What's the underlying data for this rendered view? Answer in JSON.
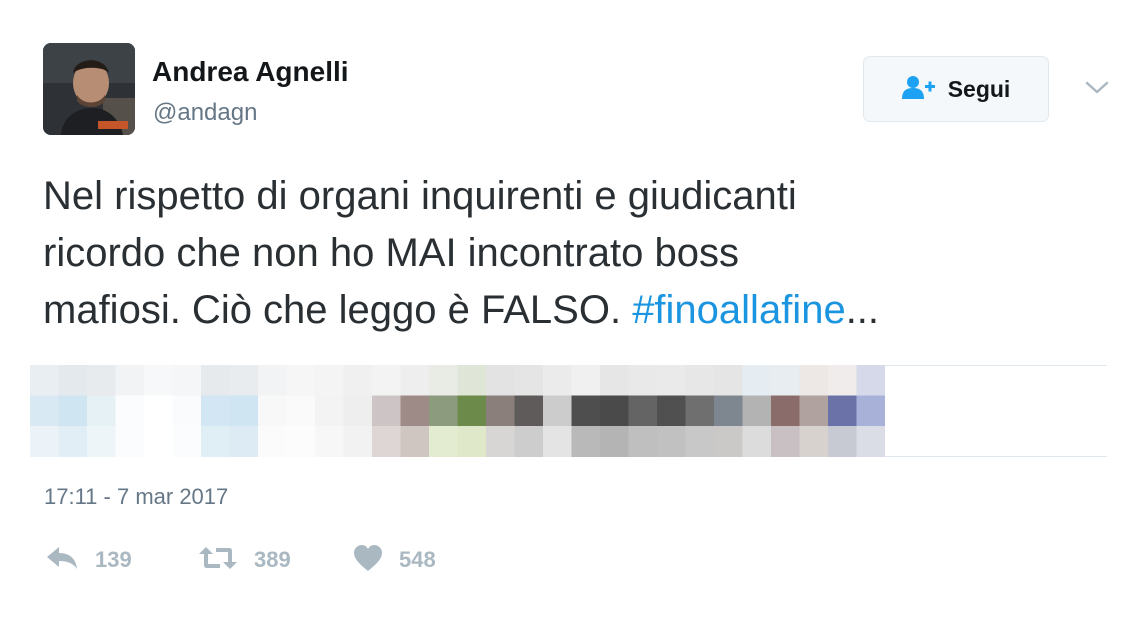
{
  "author": {
    "display_name": "Andrea Agnelli",
    "handle": "@andagn"
  },
  "follow_button": {
    "label": "Segui",
    "icon": "add-user-icon"
  },
  "more_menu": {
    "icon": "chevron-down-icon"
  },
  "tweet": {
    "text_line_1": "Nel rispetto di organi inquirenti e giudicanti",
    "text_line_2": "ricordo che non ho MAI incontrato boss",
    "text_line_3": "mafiosi. Ciò che leggo è FALSO. ",
    "hashtag": "#finoallafine",
    "truncation": "...",
    "timestamp": "17:11 - 7 mar 2017"
  },
  "actions": {
    "reply": {
      "icon": "reply-icon",
      "count": "139"
    },
    "retweet": {
      "icon": "retweet-icon",
      "count": "389"
    },
    "like": {
      "icon": "heart-icon",
      "count": "548"
    }
  },
  "colors": {
    "hashtag": "#1b95e0",
    "secondary_text": "#657786",
    "action_gray": "#aab8c2",
    "follow_icon": "#1da1f2"
  }
}
